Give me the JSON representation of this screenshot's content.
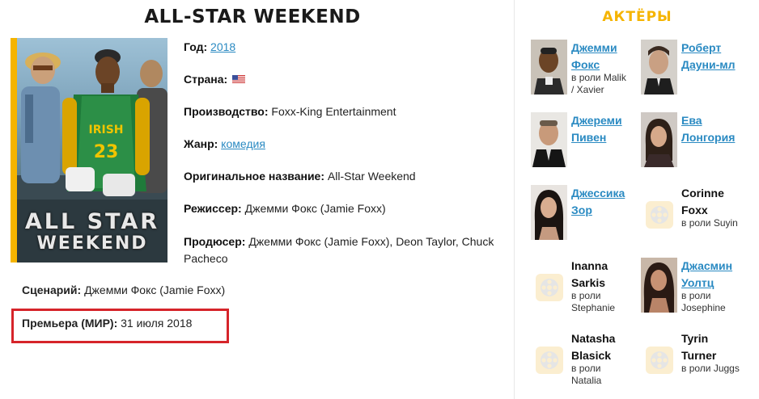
{
  "movie": {
    "title": "ALL-STAR WEEKEND",
    "poster_title_line1": "ALL STAR",
    "poster_title_line2": "WEEKEND",
    "jersey_text": "IRISH",
    "jersey_number": "23"
  },
  "info": {
    "year_label": "Год:",
    "year_value": "2018",
    "country_label": "Страна:",
    "country_flag": "usa-flag",
    "production_label": "Производство:",
    "production_value": "Foxx-King Entertainment",
    "genre_label": "Жанр:",
    "genre_value": "комедия",
    "original_label": "Оригинальное название:",
    "original_value": "All-Star Weekend",
    "director_label": "Режиссер:",
    "director_value": "Джемми Фокс (Jamie Foxx)",
    "producer_label": "Продюсер:",
    "producer_value": "Джемми Фокс (Jamie Foxx), Deon Taylor, Chuck Pacheco",
    "screenplay_label": "Сценарий:",
    "screenplay_value": "Джемми Фокс (Jamie Foxx)",
    "premiere_label": "Премьера (МИР):",
    "premiere_value": "31 июля 2018"
  },
  "actors": {
    "title": "АКТЁРЫ",
    "list": [
      {
        "name_line1": "Джемми",
        "name_line2": "Фокс",
        "role_line1": "в роли Malik",
        "role_line2": "/ Xavier",
        "linked": true
      },
      {
        "name_line1": "Роберт",
        "name_line2": "Дауни-мл",
        "role_line1": "",
        "role_line2": "",
        "linked": true
      },
      {
        "name_line1": "Джереми",
        "name_line2": "Пивен",
        "role_line1": "",
        "role_line2": "",
        "linked": true
      },
      {
        "name_line1": "Ева",
        "name_line2": "Лонгория",
        "role_line1": "",
        "role_line2": "",
        "linked": true
      },
      {
        "name_line1": "Джессика",
        "name_line2": "Зор",
        "role_line1": "",
        "role_line2": "",
        "linked": true
      },
      {
        "name_line1": "Corinne",
        "name_line2": "Foxx",
        "role_line1": "в роли Suyin",
        "role_line2": "",
        "linked": false
      },
      {
        "name_line1": "Inanna",
        "name_line2": "Sarkis",
        "role_line1": "в роли",
        "role_line2": "Stephanie",
        "linked": false
      },
      {
        "name_line1": "Джасмин",
        "name_line2": "Уолтц",
        "role_line1": "в роли",
        "role_line2": "Josephine",
        "linked": true
      },
      {
        "name_line1": "Natasha",
        "name_line2": "Blasick",
        "role_line1": "в роли",
        "role_line2": "Natalia",
        "linked": false
      },
      {
        "name_line1": "Tyrin",
        "name_line2": "Turner",
        "role_line1": "в роли Juggs",
        "role_line2": "",
        "linked": false
      }
    ]
  },
  "colors": {
    "accent": "#f5b400",
    "link": "#2a8ac2",
    "highlight_box": "#d6242a",
    "placeholder_bg": "#fbeed0"
  }
}
